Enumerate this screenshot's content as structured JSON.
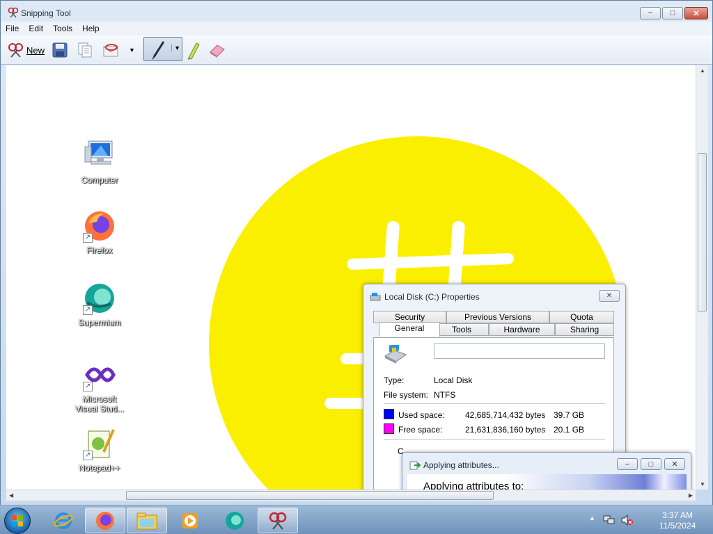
{
  "window": {
    "title": "Snipping Tool",
    "caption": {
      "minimize": "−",
      "maximize": "□",
      "close": "✕"
    }
  },
  "menu": [
    "File",
    "Edit",
    "Tools",
    "Help"
  ],
  "toolbar": {
    "new_label": "New"
  },
  "desktop_icons": [
    {
      "label": "Computer",
      "icon": "computer-icon"
    },
    {
      "label": "Firefox",
      "icon": "firefox-icon"
    },
    {
      "label": "Supermium",
      "icon": "supermium-icon"
    },
    {
      "label": "Microsoft Visual Stud...",
      "icon": "visual-studio-icon"
    },
    {
      "label": "Notepad++",
      "icon": "notepad-plus-plus-icon"
    }
  ],
  "properties_dialog": {
    "title": "Local Disk (C:) Properties",
    "tabs_row1": [
      "Security",
      "Previous Versions",
      "Quota"
    ],
    "tabs_row2": [
      "General",
      "Tools",
      "Hardware",
      "Sharing"
    ],
    "active_tab": "General",
    "name_value": "",
    "type_label": "Type:",
    "type_value": "Local Disk",
    "fs_label": "File system:",
    "fs_value": "NTFS",
    "used_label": "Used space:",
    "used_bytes": "42,685,714,432 bytes",
    "used_gb": "39.7 GB",
    "used_color": "#0000ff",
    "free_label": "Free space:",
    "free_bytes": "21,631,836,160 bytes",
    "free_gb": "20.1 GB",
    "free_color": "#ff00ff",
    "capacity_partial": "C"
  },
  "applying_dialog": {
    "title": "Applying attributes...",
    "text": "Applying attributes to:"
  },
  "taskbar": {
    "apps": [
      "internet-explorer-icon",
      "firefox-icon",
      "file-explorer-icon",
      "media-player-icon",
      "supermium-icon",
      "snipping-tool-icon"
    ],
    "time": "3:37 AM",
    "date": "11/5/2024"
  },
  "colors": {
    "sun": "#fbef00"
  }
}
